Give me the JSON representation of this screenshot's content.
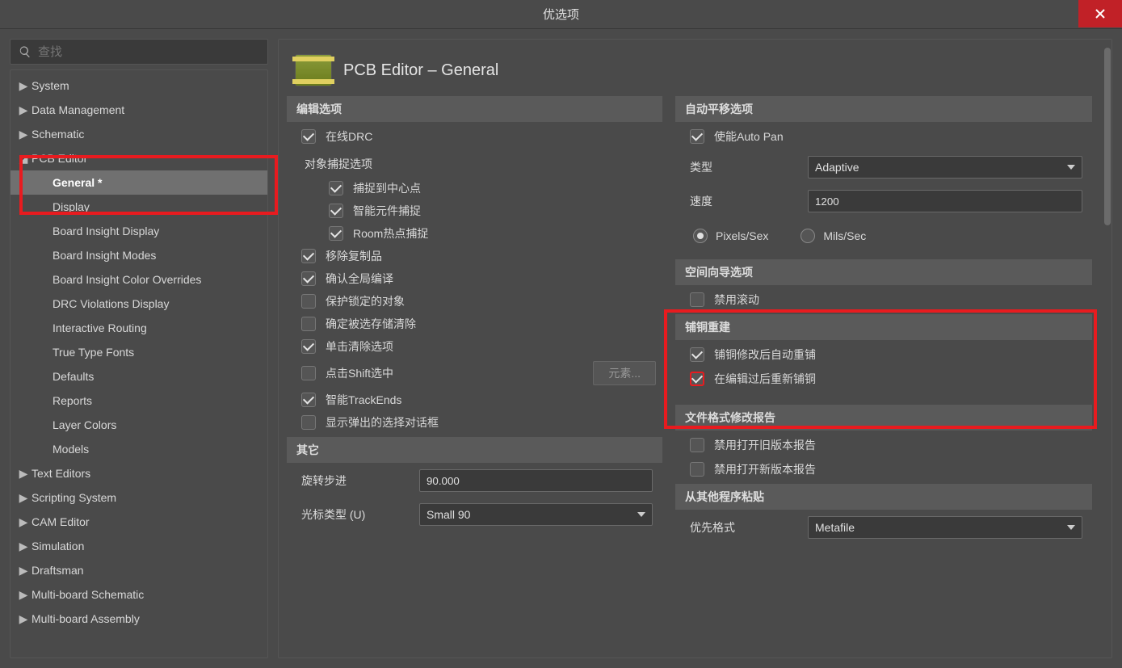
{
  "window": {
    "title": "优选项"
  },
  "search": {
    "placeholder": "查找"
  },
  "tree": {
    "top": [
      "System",
      "Data Management",
      "Schematic"
    ],
    "pcb_label": "PCB Editor",
    "pcb_children": [
      "General *",
      "Display",
      "Board Insight Display",
      "Board Insight Modes",
      "Board Insight Color Overrides",
      "DRC Violations Display",
      "Interactive Routing",
      "True Type Fonts",
      "Defaults",
      "Reports",
      "Layer Colors",
      "Models"
    ],
    "bottom": [
      "Text Editors",
      "Scripting System",
      "CAM Editor",
      "Simulation",
      "Draftsman",
      "Multi-board Schematic",
      "Multi-board Assembly"
    ]
  },
  "header": {
    "title": "PCB Editor – General"
  },
  "left": {
    "edit_opts_title": "编辑选项",
    "online_drc": "在线DRC",
    "snap_title": "对象捕捉选项",
    "snap_center": "捕捉到中心点",
    "smart_comp": "智能元件捕捉",
    "room_hotspot": "Room热点捕捉",
    "remove_dup": "移除复制品",
    "confirm_global": "确认全局编译",
    "protect_locked": "保护锁定的对象",
    "confirm_mem_clear": "确定被选存储清除",
    "click_clear": "单击清除选项",
    "shift_click": "点击Shift选中",
    "elements_btn": "元素...",
    "smart_trackends": "智能TrackEnds",
    "show_popup": "显示弹出的选择对话框",
    "misc_title": "其它",
    "rotation_step_label": "旋转步进",
    "rotation_step_value": "90.000",
    "cursor_type_label": "光标类型 (U)",
    "cursor_type_value": "Small 90"
  },
  "right": {
    "autopan_title": "自动平移选项",
    "enable_autopan": "使能Auto Pan",
    "type_label": "类型",
    "type_value": "Adaptive",
    "speed_label": "速度",
    "speed_value": "1200",
    "pixels_label": "Pixels/Sex",
    "mils_label": "Mils/Sec",
    "spacenav_title": "空间向导选项",
    "disable_scroll": "禁用滚动",
    "repour_title": "铺铜重建",
    "auto_repour": "铺铜修改后自动重铺",
    "repour_on_edit": "在编辑过后重新铺铜",
    "filefmt_title": "文件格式修改报告",
    "disable_old": "禁用打开旧版本报告",
    "disable_new": "禁用打开新版本报告",
    "paste_title": "从其他程序粘贴",
    "pref_fmt_label": "优先格式",
    "pref_fmt_value": "Metafile"
  }
}
